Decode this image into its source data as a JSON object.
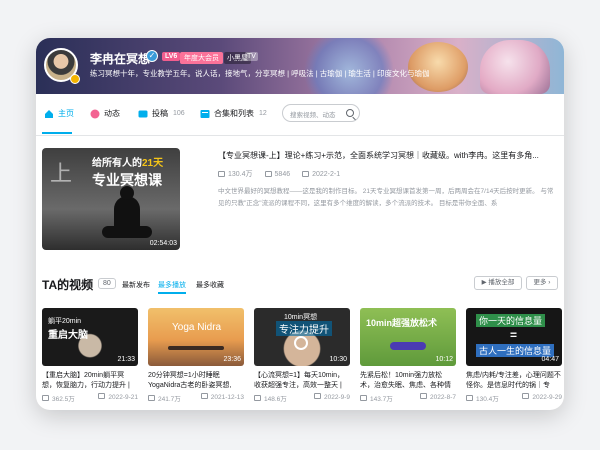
{
  "header": {
    "username": "李冉在冥想",
    "level_badge": "LV6",
    "vip_badge": "年度大会员",
    "tag_small": "小黑屋",
    "tag_tv": "TV",
    "signature": "练习冥想十年，专业教学五年。说人话，接地气，分享冥想 | 呼吸法 | 古瑜伽 | 瑜生活 | 印度文化与瑜伽"
  },
  "nav": {
    "home": "主页",
    "dynamic": "动态",
    "submissions": "投稿",
    "submissions_count": "106",
    "collections": "合集和列表",
    "collections_count": "12",
    "search_placeholder": "搜索视频、动态"
  },
  "featured": {
    "thumb_line1_a": "给所有人的",
    "thumb_line1_b": "21天",
    "thumb_line2": "专业冥想课",
    "thumb_char": "上",
    "duration": "02:54:03",
    "title": "【专业冥想课-上】理论+练习+示范，全面系统学习冥想｜收藏级。with李冉。这里有多角...",
    "views": "130.4万",
    "danmaku": "5846",
    "date": "2022-2-1",
    "description": "中文世界最好的冥想教程——这是我的制作目标。 21天专业冥想课首发第一周，后两周会在7/14天后按时更新。 与常见的只教\"正念\"流派的课程不同，这里有多个维度的解读，多个流派的技术。 目标是带你全面、系"
  },
  "section": {
    "title": "TA的视频",
    "count": "80",
    "sort_new": "最新发布",
    "sort_play": "最多播放",
    "sort_fav": "最多收藏",
    "play_all": "播放全部",
    "more": "更多"
  },
  "videos": [
    {
      "thumb_a": "躺平20min",
      "thumb_b": "重启大脑",
      "duration": "21:33",
      "title": "【重启大脑】20min躺平冥想，恢复脑力，行动力提升 |",
      "views": "362.5万",
      "date": "2022-9-21"
    },
    {
      "thumb_a": "Yoga Nidra",
      "thumb_b": "",
      "duration": "23:36",
      "title": "20分钟冥想=1小时睡眠 YogaNidra古老的卧姿冥想,",
      "views": "241.7万",
      "date": "2021-12-13"
    },
    {
      "thumb_a": "10min冥想",
      "thumb_b": "专注力提升",
      "duration": "10:30",
      "title": "【心流冥想=1】每天10min，收获超强专注，高效一整天 | 专",
      "views": "148.6万",
      "date": "2022-9-9"
    },
    {
      "thumb_a": "10min超强放松术",
      "thumb_b": "",
      "duration": "10:12",
      "title": "先紧后松！10min强力放松术，治愈失眠、焦虑、各种情",
      "views": "143.7万",
      "date": "2022-8-7"
    },
    {
      "thumb_a": "你一天的信息量",
      "thumb_b": "古人一生的信息量",
      "duration": "04:47",
      "title": "焦虑/内耗/专注差，心理问题不怪你。是信息时代的锅｜专",
      "views": "130.4万",
      "date": "2022-9-29"
    }
  ],
  "colors": {
    "accent": "#00aeec",
    "vip": "#fb7299",
    "level": "#f25d8e"
  }
}
